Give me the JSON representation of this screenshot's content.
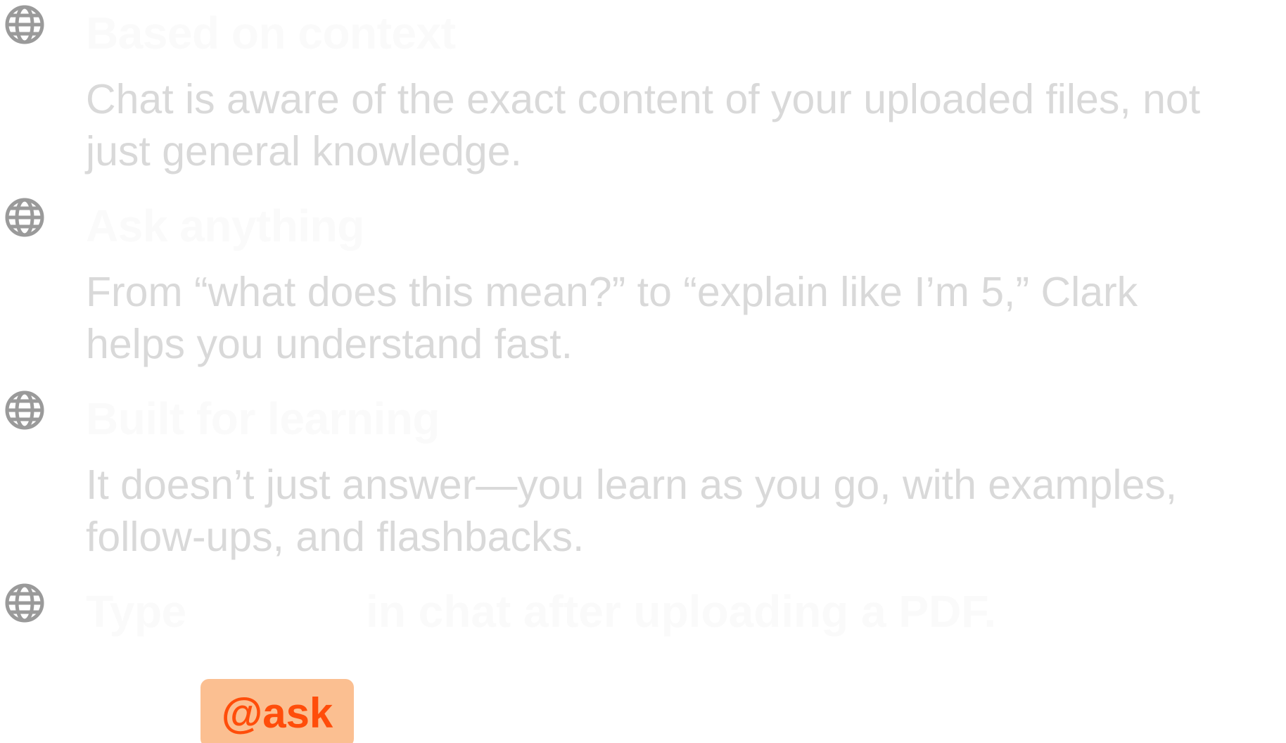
{
  "features": [
    {
      "icon": "globe-icon",
      "title": "Based on context",
      "desc_line1": "Chat is aware of the exact content of your uploaded files, not",
      "desc_line2": "just general knowledge."
    },
    {
      "icon": "globe-icon",
      "title": "Ask anything",
      "desc_line1": "From “what does this mean?” to “explain like I’m 5,” Clark",
      "desc_line2": "helps you understand fast."
    },
    {
      "icon": "globe-icon",
      "title": "Built for learning",
      "desc_line1": "It doesn’t just answer—you learn as you go, with examples,",
      "desc_line2": "follow-ups, and flashbacks."
    }
  ],
  "tip": {
    "icon": "globe-icon",
    "prefix": "Type",
    "command": "@ask",
    "suffix": "in chat after uploading a PDF."
  },
  "colors": {
    "icon": "#9a9a9a",
    "title": "#fafafa",
    "description": "#d9d9d9",
    "badge_bg": "#fbbf91",
    "badge_text": "#ff4d0a"
  }
}
